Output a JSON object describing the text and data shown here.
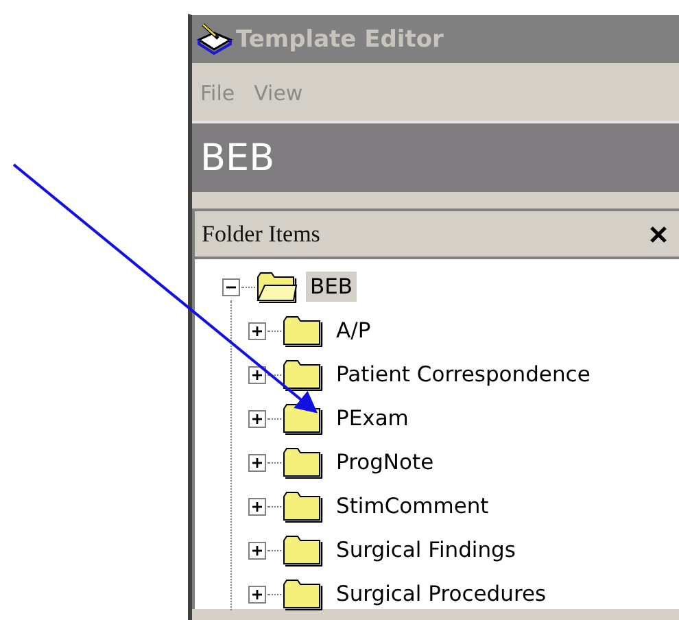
{
  "window": {
    "title": "Template Editor"
  },
  "menu": [
    {
      "label": "File"
    },
    {
      "label": "View"
    }
  ],
  "header": {
    "title": "BEB"
  },
  "panel": {
    "title": "Folder Items"
  },
  "tree": [
    {
      "label": "BEB",
      "expanded": true,
      "selected": true,
      "children": [
        {
          "label": "A/P",
          "expanded": false,
          "selected": false
        },
        {
          "label": "Patient Correspondence",
          "expanded": false,
          "selected": false
        },
        {
          "label": "PExam",
          "expanded": false,
          "selected": false
        },
        {
          "label": "ProgNote",
          "expanded": false,
          "selected": false
        },
        {
          "label": "StimComment",
          "expanded": false,
          "selected": false
        },
        {
          "label": "Surgical Findings",
          "expanded": false,
          "selected": false
        },
        {
          "label": "Surgical Procedures",
          "expanded": false,
          "selected": false
        }
      ]
    }
  ]
}
